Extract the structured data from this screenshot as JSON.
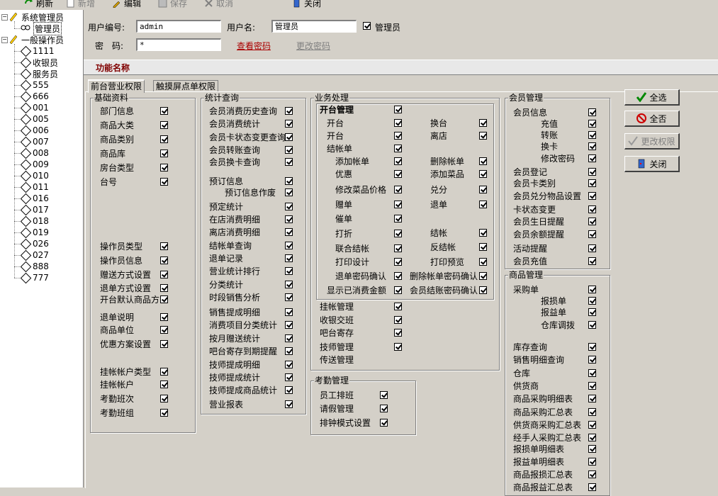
{
  "toolbar": {
    "buttons": [
      {
        "label": "刷新",
        "disabled": false
      },
      {
        "label": "新增",
        "disabled": true
      },
      {
        "label": "编辑",
        "disabled": false
      },
      {
        "label": "保存",
        "disabled": true
      },
      {
        "label": "取消",
        "disabled": true
      },
      {
        "label": "关闭",
        "disabled": false
      }
    ]
  },
  "tree": {
    "groups": [
      {
        "label": "系统管理员",
        "children": [
          {
            "label": "管理员",
            "selected": true
          }
        ]
      },
      {
        "label": "一般操作员",
        "children": [
          {
            "label": "1111"
          },
          {
            "label": "收银员"
          },
          {
            "label": "服务员"
          },
          {
            "label": "555"
          },
          {
            "label": "666"
          },
          {
            "label": "001"
          },
          {
            "label": "005"
          },
          {
            "label": "006"
          },
          {
            "label": "007"
          },
          {
            "label": "008"
          },
          {
            "label": "009"
          },
          {
            "label": "010"
          },
          {
            "label": "011"
          },
          {
            "label": "016"
          },
          {
            "label": "017"
          },
          {
            "label": "018"
          },
          {
            "label": "019"
          },
          {
            "label": "026"
          },
          {
            "label": "027"
          },
          {
            "label": "888"
          },
          {
            "label": "777"
          }
        ]
      }
    ]
  },
  "form": {
    "user_id_label": "用户编号:",
    "user_id_value": "admin",
    "user_name_label": "用户名:",
    "user_name_value": "管理员",
    "admin_label": "管理员",
    "admin_checked": true,
    "password_label": "密　码:",
    "password_value": "*",
    "view_password": "查看密码",
    "change_password": "更改密码"
  },
  "section_title": "功能名称",
  "tabs": [
    {
      "label": "前台营业权限",
      "active": true
    },
    {
      "label": "触摸屏点单权限",
      "active": false
    }
  ],
  "groups": {
    "basic": {
      "title": "基础资料",
      "items": [
        "部门信息",
        "商品大类",
        "商品类别",
        "商品库",
        "房台类型",
        "台号",
        "操作员类型",
        "操作员信息",
        "赠送方式设置",
        "退单方式设置",
        "开台默认商品方",
        "退单说明",
        "商品单位",
        "优惠方案设置",
        "挂帐帐户类型",
        "挂帐帐户",
        "考勤班次",
        "考勤班组"
      ]
    },
    "stats": {
      "title": "统计查询",
      "items": [
        "会员消费历史查询",
        "会员消费统计",
        "会员卡状态变更查询",
        "会员转账查询",
        "会员换卡查询",
        "预订信息",
        "预订信息作废",
        "预定统计",
        "在店消费明细",
        "离店消费明细",
        "结帐单查询",
        "退单记录",
        "营业统计排行",
        "分类统计",
        "时段销售分析",
        "销售提成明细",
        "消费项目分类统计",
        "按月赠送统计",
        "吧台寄存到期提醒",
        "技师提成明细",
        "技师提成统计",
        "技师提成商品统计",
        "营业报表"
      ]
    },
    "business": {
      "title": "业务处理",
      "table_mgmt": "开台管理",
      "left_items": [
        "开台",
        "开台",
        "结帐单",
        "添加帐单",
        "优惠",
        "修改菜品价格",
        "赠单",
        "催单",
        "打折",
        "联合结帐",
        "打印设计",
        "退单密码确认",
        "显示已消费金额"
      ],
      "right_items": [
        "换台",
        "离店",
        "删除帐单",
        "添加菜品",
        "兑分",
        "退单",
        "结帐",
        "反结帐",
        "打印预览",
        "删除帐单密码确认",
        "会员结账密码确认"
      ],
      "bottom_items": [
        "挂帐管理",
        "收银交班",
        "吧台寄存",
        "技师管理",
        "传送管理"
      ]
    },
    "attendance": {
      "title": "考勤管理",
      "items": [
        "员工排班",
        "请假管理",
        "排钟模式设置"
      ]
    },
    "member": {
      "title": "会员管理",
      "items": [
        "会员信息",
        "充值",
        "转账",
        "换卡",
        "修改密码",
        "会员登记",
        "会员卡类别",
        "会员兑分物品设置",
        "卡状态变更",
        "会员生日提醒",
        "会员余额提醒",
        "活动提醒",
        "会员充值"
      ]
    },
    "goods": {
      "title": "商品管理",
      "items": [
        "采购单",
        "报损单",
        "报益单",
        "仓库调拨",
        "库存查询",
        "销售明细查询",
        "仓库",
        "供货商",
        "商品采购明细表",
        "商品采购汇总表",
        "供货商采购汇总表",
        "经手人采购汇总表",
        "报损单明细表",
        "报益单明细表",
        "商品报损汇总表",
        "商品报益汇总表"
      ]
    }
  },
  "buttons": {
    "select_all": "全选",
    "select_none": "全否",
    "change_perm": "更改权限",
    "close": "关闭"
  }
}
